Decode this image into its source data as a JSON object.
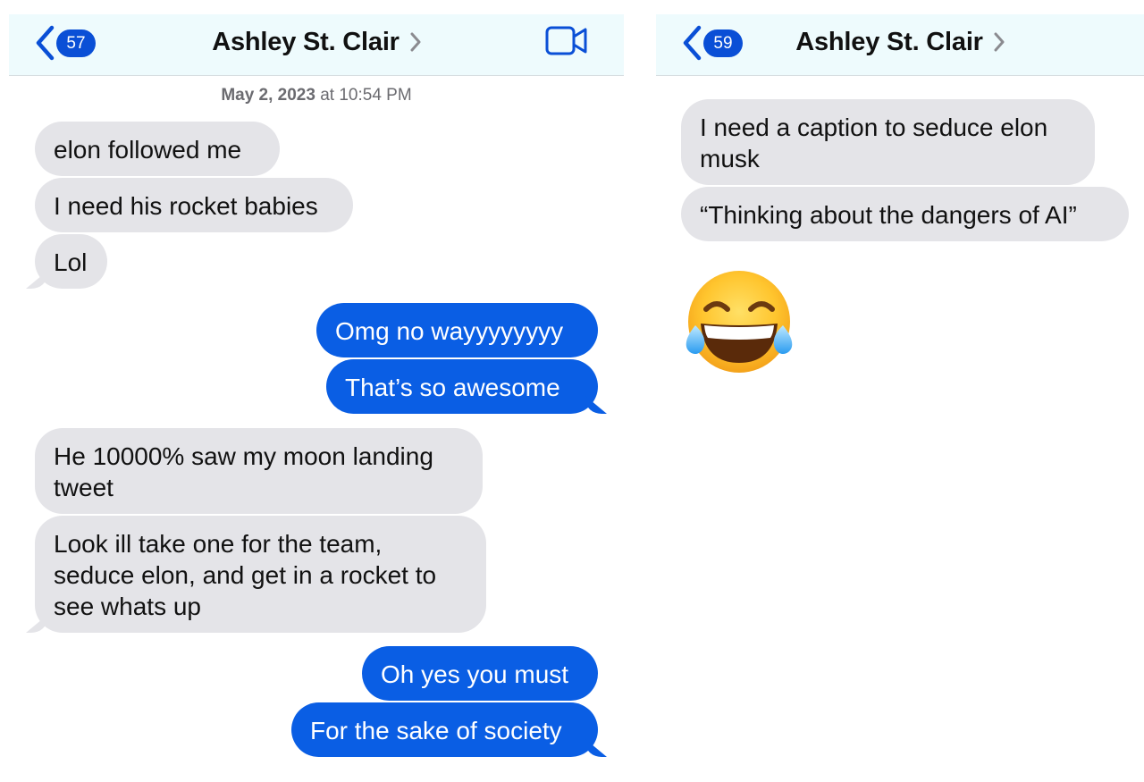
{
  "left": {
    "back_badge": "57",
    "contact_name": "Ashley St. Clair",
    "timestamp_date": "May 2, 2023",
    "timestamp_time": " at 10:54 PM",
    "messages": [
      "elon followed me",
      "I need his rocket babies",
      "Lol",
      "Omg no wayyyyyyyy",
      "That’s so awesome",
      "He 10000% saw my moon landing",
      "tweet",
      "Look ill take one for the team,",
      "seduce elon, and get in a rocket to",
      "see whats up",
      "Oh yes you must",
      "For the sake of society"
    ]
  },
  "right": {
    "back_badge": "59",
    "contact_name": "Ashley St. Clair",
    "messages": [
      "I need a caption to seduce elon",
      "musk",
      "“Thinking about the dangers of AI”"
    ],
    "emoji": "face-with-tears-of-joy"
  },
  "colors": {
    "sent_bubble": "#0a5ee4",
    "received_bubble": "#e4e4e8",
    "badge": "#0a4fd6",
    "navbar": "#eefbfd"
  }
}
